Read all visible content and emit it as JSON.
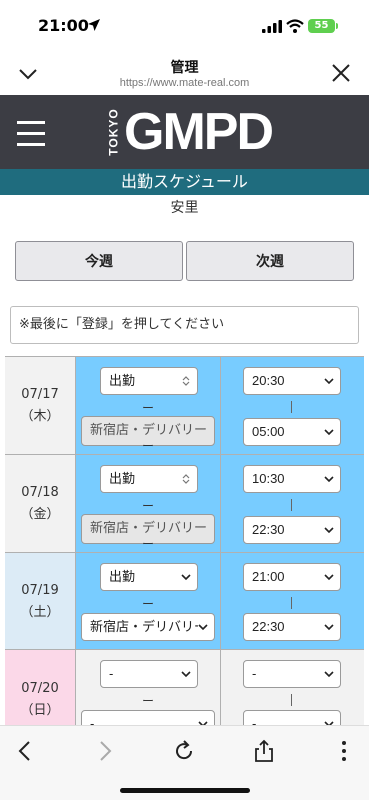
{
  "status_bar": {
    "time": "21:00",
    "battery": "55"
  },
  "browser": {
    "title": "管理",
    "url": "https://www.mate-real.com"
  },
  "site": {
    "logo_sub": "TOKYO",
    "logo_main": "GMPD"
  },
  "section_title": "出勤スケジュール",
  "person_name": "安里",
  "buttons": {
    "this_week": "今週",
    "next_week": "次週"
  },
  "notice": "※最後に「登録」を押してください",
  "colors": {
    "active": "#78ccff",
    "saturday": "#dcebf6",
    "sunday": "#fbd8e8",
    "weekday": "#f2f2f2",
    "header_bar": "#1f6c7e"
  },
  "schedule": [
    {
      "date": "07/17",
      "weekday": "（木）",
      "status": "出勤",
      "store": "新宿店・デリバリー",
      "start": "20:30",
      "end": "05:00"
    },
    {
      "date": "07/18",
      "weekday": "（金）",
      "status": "出勤",
      "store": "新宿店・デリバリー",
      "start": "10:30",
      "end": "22:30"
    },
    {
      "date": "07/19",
      "weekday": "（土）",
      "status": "出勤",
      "store": "新宿店・デリバリー",
      "start": "21:00",
      "end": "22:30"
    },
    {
      "date": "07/20",
      "weekday": "（日）",
      "status": "-",
      "store": "-",
      "start": "-",
      "end": "-"
    }
  ],
  "separator": "ー"
}
